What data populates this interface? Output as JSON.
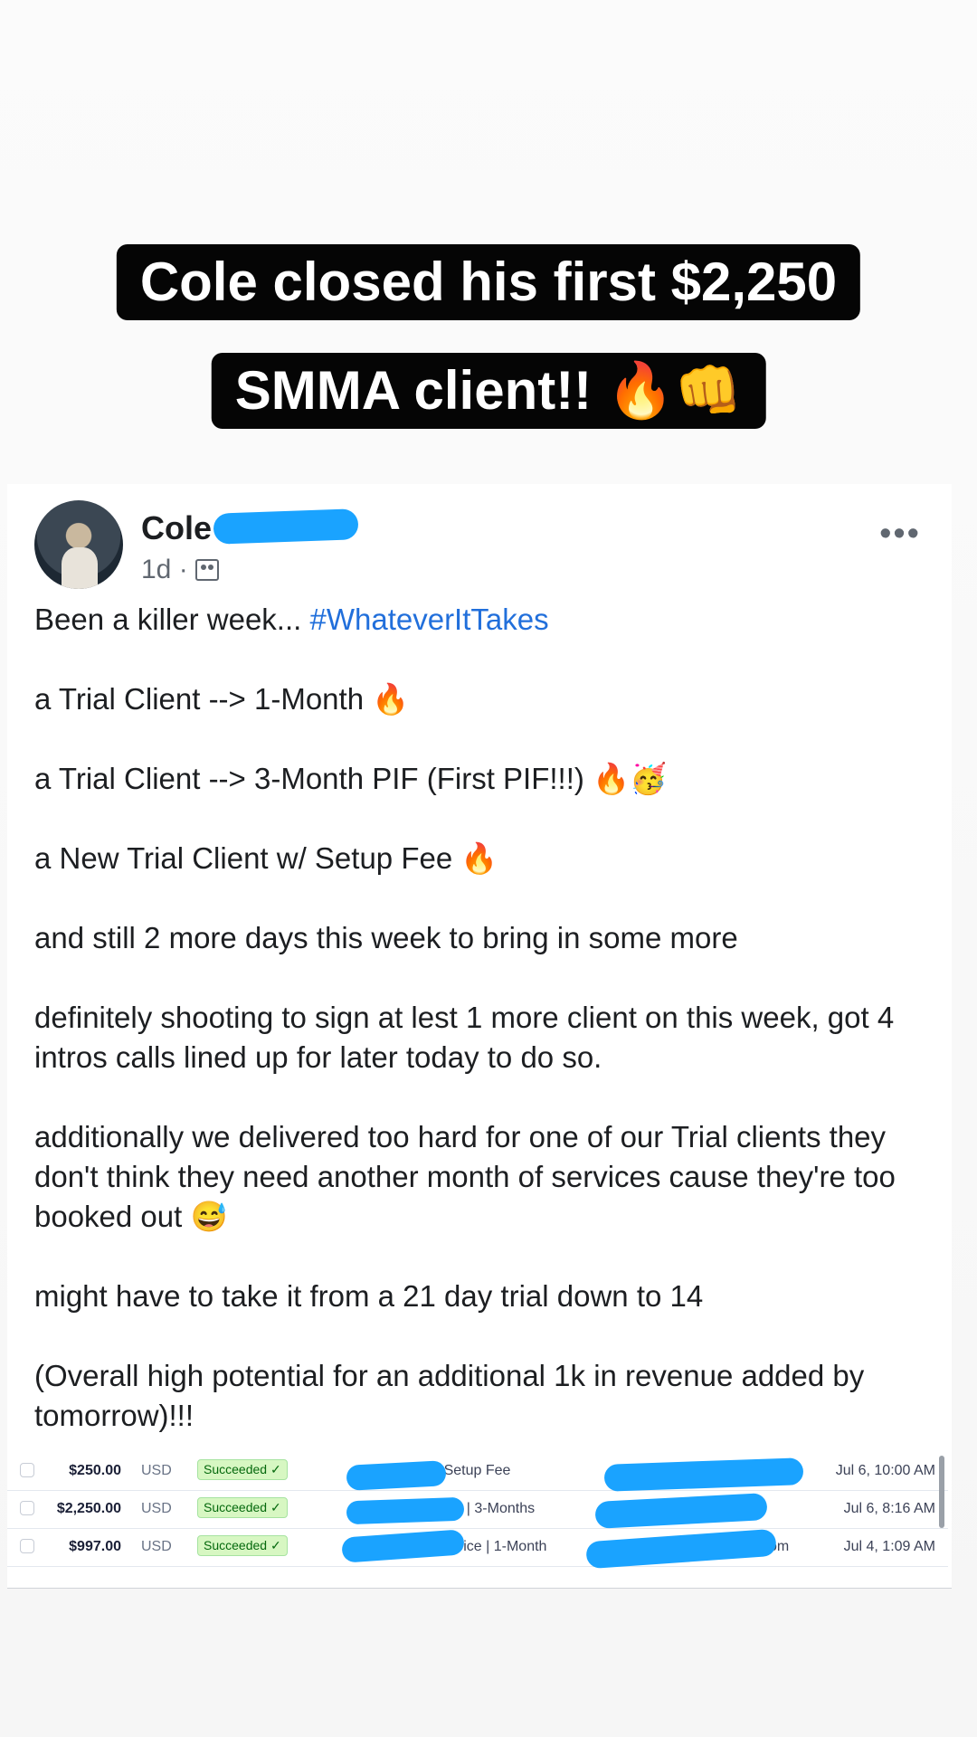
{
  "caption": {
    "line1": "Cole closed his first $2,250",
    "line2": "SMMA client!!",
    "emojis": "🔥👊"
  },
  "post": {
    "author": "Cole",
    "time": "1d ·",
    "audience_icon": "friends-icon",
    "more_icon": "•••",
    "lines": [
      "Been a killer week...",
      "a Trial Client --> 1-Month 🔥",
      "a Trial Client --> 3-Month PIF (First PIF!!!) 🔥🥳",
      "a New Trial Client w/ Setup Fee 🔥",
      "and still 2 more days this week to bring in some more",
      "definitely shooting to sign at lest 1 more client on this week, got 4 intros calls lined up for later today to do so.",
      "additionally we delivered too hard for one of our Trial clients they don't think they need another month of services cause they're too booked out 😅",
      "might have to take it from a 21 day trial down to 14",
      "(Overall high potential for an additional 1k in revenue added by tomorrow)!!!"
    ],
    "hashtag": "#WhateverItTakes"
  },
  "payments": [
    {
      "amount": "$250.00",
      "currency": "USD",
      "status": "Succeeded ✓",
      "description": "| Setup Fee",
      "email": "",
      "date": "Jul 6, 10:00 AM"
    },
    {
      "amount": "$2,250.00",
      "currency": "USD",
      "status": "Succeeded ✓",
      "description": "oice | 3-Months",
      "email": "",
      "date": "Jul 6, 8:16 AM"
    },
    {
      "amount": "$997.00",
      "currency": "USD",
      "status": "Succeeded ✓",
      "description": "Invoice | 1-Month",
      "email": "om",
      "date": "Jul 4, 1:09 AM"
    }
  ]
}
